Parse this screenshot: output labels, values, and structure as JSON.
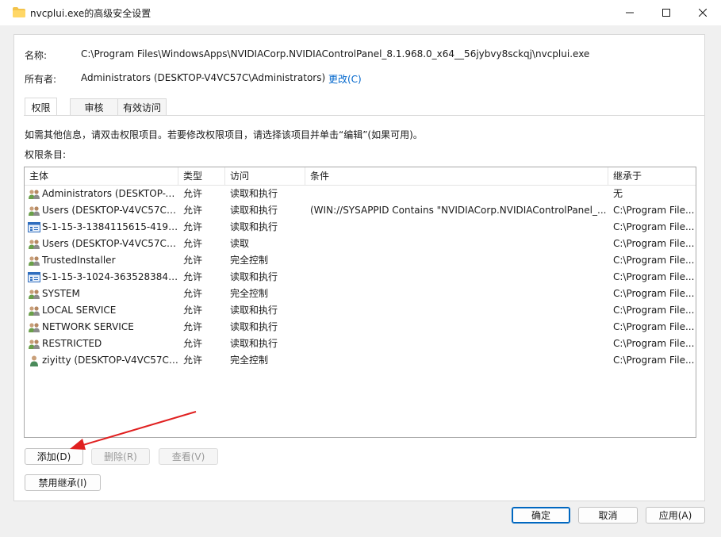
{
  "window": {
    "title": "nvcplui.exe的高级安全设置",
    "icon": "folder-icon",
    "controls": [
      "minimize-icon",
      "maximize-icon",
      "close-icon"
    ]
  },
  "info": {
    "name_label": "名称:",
    "name_value": "C:\\Program Files\\WindowsApps\\NVIDIACorp.NVIDIAControlPanel_8.1.968.0_x64__56jybvy8sckqj\\nvcplui.exe",
    "owner_label": "所有者:",
    "owner_value": "Administrators (DESKTOP-V4VC57C\\Administrators)",
    "change_link": "更改(C)"
  },
  "tabs": [
    {
      "label": "权限",
      "active": true
    },
    {
      "label": "审核",
      "active": false
    },
    {
      "label": "有效访问",
      "active": false
    }
  ],
  "hint_text": "如需其他信息，请双击权限项目。若要修改权限项目，请选择该项目并单击“编辑”(如果可用)。",
  "entries_label": "权限条目:",
  "columns": [
    "主体",
    "类型",
    "访问",
    "条件",
    "继承于"
  ],
  "rows": [
    {
      "icon": "group-icon",
      "principal": "Administrators (DESKTOP-V...",
      "type": "允许",
      "access": "读取和执行",
      "condition": "",
      "inherited": "无"
    },
    {
      "icon": "group-icon",
      "principal": "Users (DESKTOP-V4VC57C\\...",
      "type": "允许",
      "access": "读取和执行",
      "condition": "(WIN://SYSAPPID Contains \"NVIDIACorp.NVIDIAControlPanel_...",
      "inherited": "C:\\Program File..."
    },
    {
      "icon": "sid-icon",
      "principal": "S-1-15-3-1384115615-4197...",
      "type": "允许",
      "access": "读取和执行",
      "condition": "",
      "inherited": "C:\\Program File..."
    },
    {
      "icon": "group-icon",
      "principal": "Users (DESKTOP-V4VC57C\\...",
      "type": "允许",
      "access": "读取",
      "condition": "",
      "inherited": "C:\\Program File..."
    },
    {
      "icon": "group-icon",
      "principal": "TrustedInstaller",
      "type": "允许",
      "access": "完全控制",
      "condition": "",
      "inherited": "C:\\Program File..."
    },
    {
      "icon": "sid-icon",
      "principal": "S-1-15-3-1024-3635283841...",
      "type": "允许",
      "access": "读取和执行",
      "condition": "",
      "inherited": "C:\\Program File..."
    },
    {
      "icon": "group-icon",
      "principal": "SYSTEM",
      "type": "允许",
      "access": "完全控制",
      "condition": "",
      "inherited": "C:\\Program File..."
    },
    {
      "icon": "group-icon",
      "principal": "LOCAL SERVICE",
      "type": "允许",
      "access": "读取和执行",
      "condition": "",
      "inherited": "C:\\Program File..."
    },
    {
      "icon": "group-icon",
      "principal": "NETWORK SERVICE",
      "type": "允许",
      "access": "读取和执行",
      "condition": "",
      "inherited": "C:\\Program File..."
    },
    {
      "icon": "group-icon",
      "principal": "RESTRICTED",
      "type": "允许",
      "access": "读取和执行",
      "condition": "",
      "inherited": "C:\\Program File..."
    },
    {
      "icon": "user-icon",
      "principal": "ziyitty (DESKTOP-V4VC57C\\...",
      "type": "允许",
      "access": "完全控制",
      "condition": "",
      "inherited": "C:\\Program File..."
    }
  ],
  "buttons": {
    "add": "添加(D)",
    "remove": "删除(R)",
    "view": "查看(V)",
    "disable_inheritance": "禁用继承(I)",
    "ok": "确定",
    "cancel": "取消",
    "apply": "应用(A)"
  },
  "colors": {
    "link": "#0066cc",
    "annotation_arrow": "#e02020",
    "primary_border": "#0067c0"
  }
}
